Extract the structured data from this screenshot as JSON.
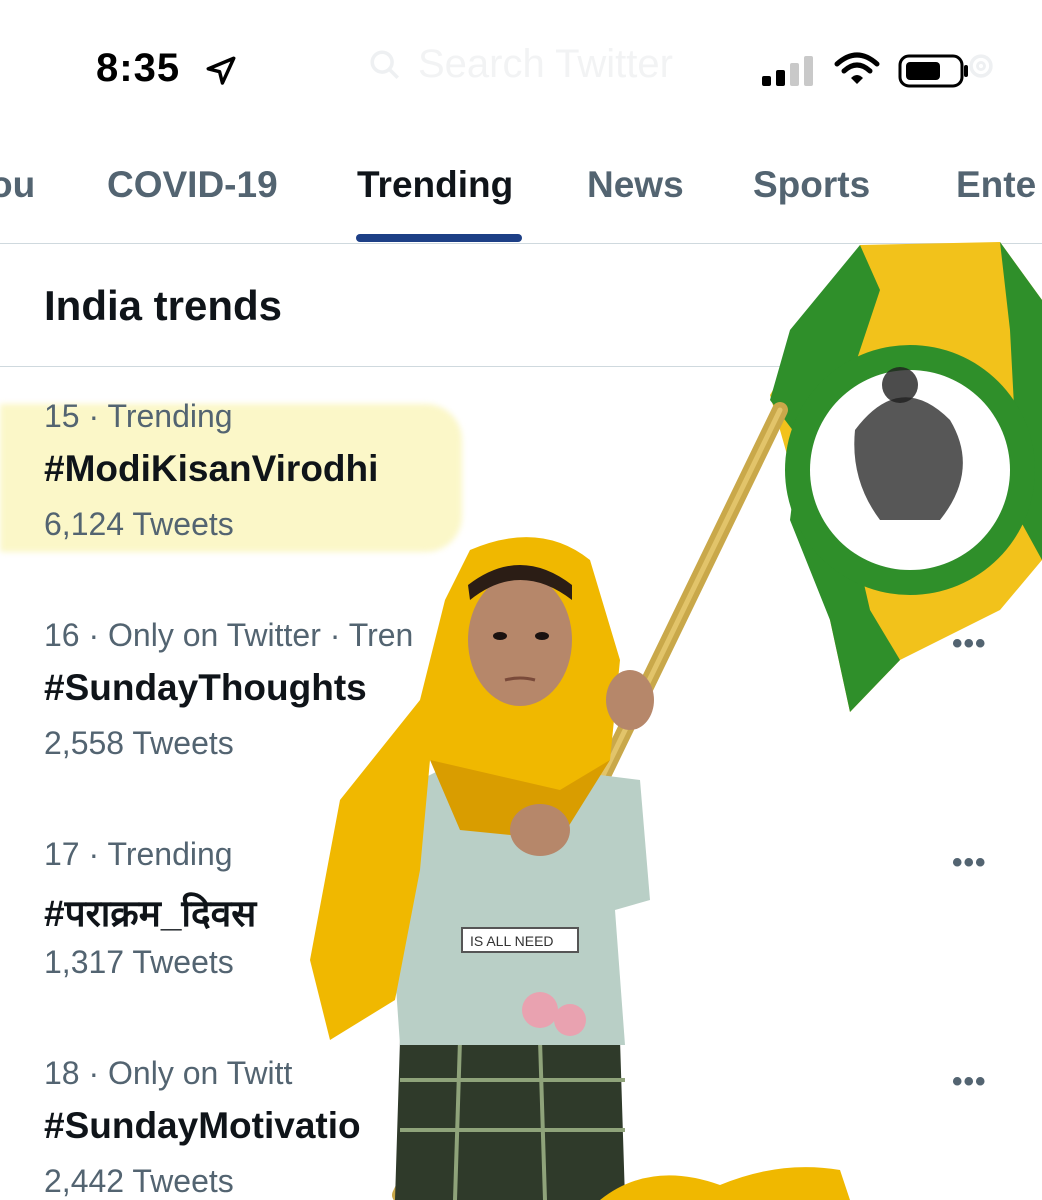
{
  "status_bar": {
    "time": "8:35",
    "search_ghost": "Search Twitter"
  },
  "tabs": [
    {
      "label": "ou"
    },
    {
      "label": "COVID-19"
    },
    {
      "label": "Trending",
      "active": true
    },
    {
      "label": "News"
    },
    {
      "label": "Sports"
    },
    {
      "label": "Ente"
    }
  ],
  "section": {
    "title": "India trends"
  },
  "trends": [
    {
      "meta": "15 · Trending",
      "tag": "#ModiKisanVirodhi",
      "count": "6,124 Tweets",
      "highlighted": true
    },
    {
      "meta": "16 · Only on Twitter · Tren",
      "tag": "#SundayThoughts",
      "count": "2,558 Tweets"
    },
    {
      "meta": "17 · Trending",
      "tag": "#पराक्रम_दिवस",
      "count": "1,317 Tweets"
    },
    {
      "meta": "18 · Only on Twitt",
      "tag": "#SundayMotivatio",
      "count": "2,442 Tweets"
    }
  ],
  "more_label": "•••",
  "photo_text": {
    "shirt": "IS ALL NEED"
  },
  "colors": {
    "accent": "#1d3f86",
    "secondary_text": "#536471",
    "highlight": "#fbf7c8",
    "flag_green": "#2f8f2a",
    "flag_yellow": "#f2c21b",
    "scarf_yellow": "#f0b800"
  }
}
